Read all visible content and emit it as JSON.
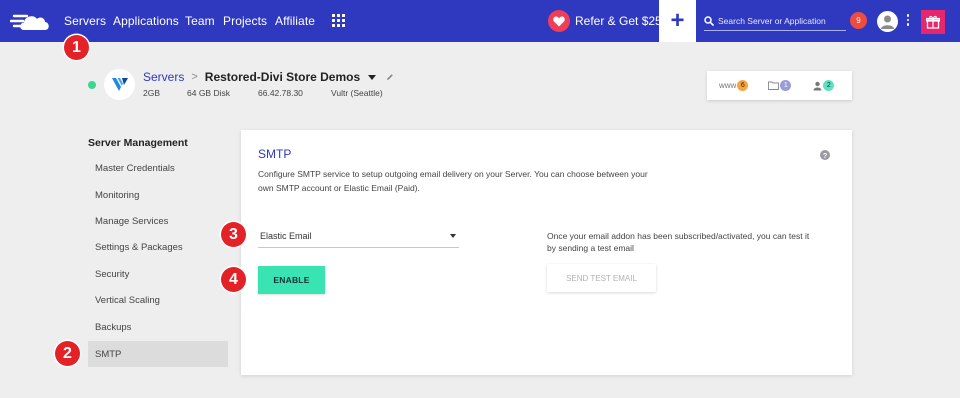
{
  "nav": {
    "links": [
      "Servers",
      "Applications",
      "Team",
      "Projects",
      "Affiliate"
    ],
    "refer_label": "Refer & Get $25",
    "plus_label": "+",
    "search_placeholder": "Search Server or Application",
    "notifications_count": "9"
  },
  "server": {
    "breadcrumb_root": "Servers",
    "name": "Restored-Divi Store Demos",
    "ram": "2GB",
    "disk": "64 GB Disk",
    "ip": "66.42.78.30",
    "provider": "Vultr (Seattle)",
    "stats": [
      {
        "label": "www",
        "count": "6",
        "color": "#f5a540"
      },
      {
        "label": "",
        "count": "1",
        "color": "#9a9bd9"
      },
      {
        "label": "",
        "count": "2",
        "color": "#5fe0c0"
      }
    ]
  },
  "sidebar": {
    "title": "Server Management",
    "items": [
      "Master Credentials",
      "Monitoring",
      "Manage Services",
      "Settings & Packages",
      "Security",
      "Vertical Scaling",
      "Backups",
      "SMTP"
    ],
    "active_index": 7
  },
  "smtp": {
    "title": "SMTP",
    "help": "?",
    "description": "Configure SMTP service to setup outgoing email delivery on your Server. You can choose between your own SMTP account or Elastic Email (Paid).",
    "selected_option": "Elastic Email",
    "enable_label": "ENABLE",
    "note": "Once your email addon has been subscribed/activated, you can test it by sending a test email",
    "send_test_label": "SEND TEST EMAIL"
  },
  "markers": [
    "1",
    "2",
    "3",
    "4"
  ],
  "colors": {
    "nav_bg": "#2f39bf",
    "accent_green": "#3ae3b2",
    "marker_red": "#e32227",
    "refer_red": "#ef3e56",
    "gift_pink": "#e7266d",
    "status_green": "#3dd68c"
  }
}
